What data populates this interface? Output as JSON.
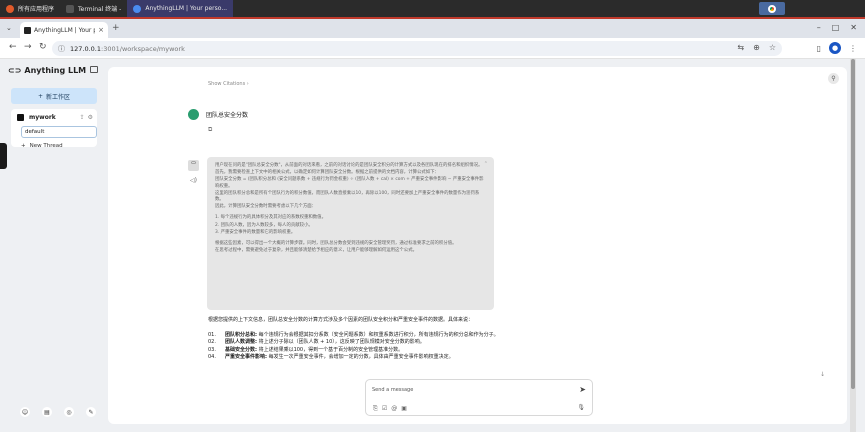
{
  "taskbar": {
    "items": [
      {
        "label": "所有应用程序",
        "icon": "apps-menu-icon",
        "color": "#e05a2a"
      },
      {
        "label": "Terminal 终端 -",
        "icon": "terminal-icon",
        "color": "#555555"
      },
      {
        "label": "AnythingLLM | Your perso...",
        "icon": "chrome-icon",
        "color": "#4a8cf0"
      }
    ]
  },
  "browser": {
    "tab_title": "AnythingLLM | Your person",
    "url_host": "127.0.0.1",
    "url_path": ":3001/workspace/mywork"
  },
  "sidebar": {
    "brand": "Anything LLM",
    "new_workspace": "新工作区",
    "workspace": "mywork",
    "thread": "default",
    "new_thread": "New Thread"
  },
  "chat": {
    "show_citations": "Show Citations",
    "user_message": "团队总安全分数",
    "thinking": [
      "用户现在问的是\"团队总安全分数\"，从前面的对话来看，之前的对话讨论的是团队安全积分的计算方式以及各团队现在的排名和组织情况。",
      "首先，我需要检查上下文中的相关公式，以确定如何计算团队安全分数。根据之前提供的文档内容，计算公式如下：",
      "团队安全分数 = (团队积分总和 (安全问题系数 + 违规行为罚金权重) ÷ (团队人数 + cal) × com + 严重安全事件影响 − 严重安全事件影响权重。",
      "这里的团队积分总和是所有个团队行为的积分数值，而团队人数直接乘以10，再除以100，同时还要加上严重安全事件的数量作为惩罚系数。",
      "因此，计算团队安全分数时需要考虑以下几个方面：",
      "",
      "1.   每个违规行为的具体积分及其对应的系数权重和数值。",
      "2.   团队的人数，因为人数较多，每人的贡献较小。",
      "3.   严重安全事件的数量和它的影响权重。",
      "",
      "根据这些因素，可以得出一个大概的计算步骤。同时，团队总分数会受到违规的安全管理奖罚，通过标准要求之前的积分值。",
      "在思考过程中，需要避免过于复杂，并且能够清楚给予相应的意义，让用户能够理解如何运用这个公式。"
    ],
    "answer_intro": "根据您提供的上下文信息，团队总安全分数的计算方式涉及多个因素的团队安全积分和严重安全事件的数据。具体来说：",
    "answer_points": [
      {
        "num": "01.",
        "term": "团队积分总和:",
        "text": "每个违规行为会根据其扣分系数（安全问题系数）和权重系数进行积分，所有违规行为的积分总和作为分子。"
      },
      {
        "num": "02.",
        "term": "团队人数调整:",
        "text": "将上述分子除以（团队人数 + 10），这反映了团队规模对安全分数的影响。"
      },
      {
        "num": "03.",
        "term": "基础安全分数:",
        "text": "将上述结果乘以100，得到一个基于百分制的安全管理基准分数。"
      },
      {
        "num": "04.",
        "term": "严重安全事件影响:",
        "text": "每发生一次严重安全事件，会增加一定的分数，具体由严重安全事件影响权重决定。"
      }
    ],
    "composer_placeholder": "Send a message"
  }
}
